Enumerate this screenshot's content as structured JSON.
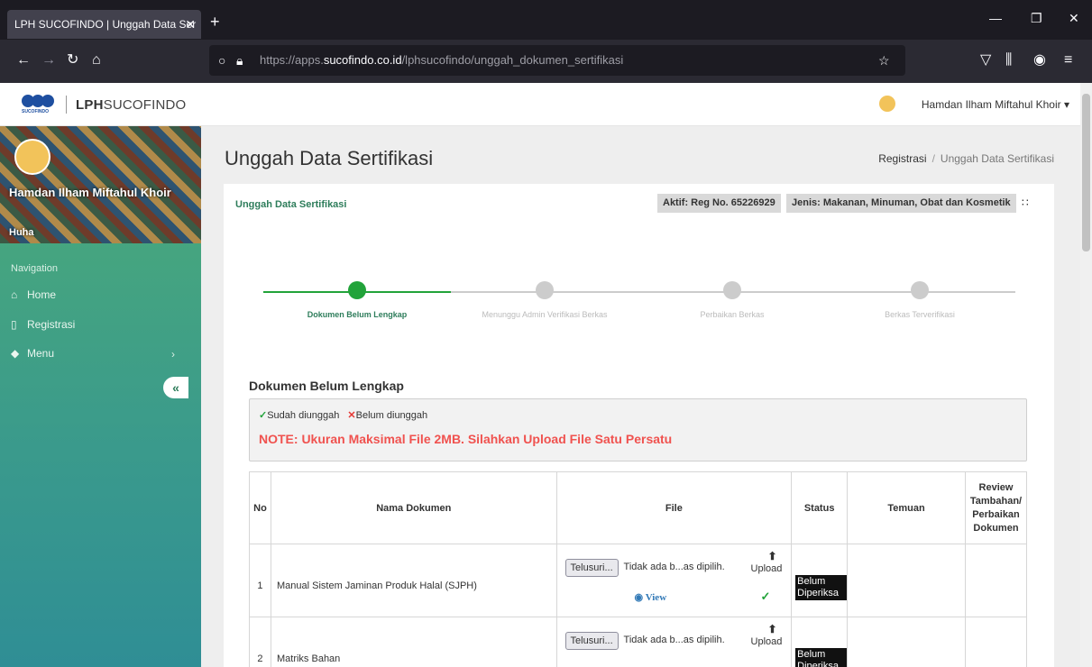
{
  "browser": {
    "tab_title": "LPH SUCOFINDO | Unggah Data Ser",
    "tab_close": "✕",
    "new_tab": "+",
    "url_prefix": "https://apps.",
    "url_domain": "sucofindo.co.id",
    "url_path": "/lphsucofindo/unggah_dokumen_sertifikasi"
  },
  "header": {
    "logo_text": "SUCOFINDO",
    "brand_bold": "LPH",
    "brand_rest": "SUCOFINDO",
    "user_name": "Hamdan Ilham Miftahul Khoir"
  },
  "sidebar": {
    "profile_name": "Hamdan Ilham Miftahul Khoir",
    "profile_username": "Huha",
    "nav_label": "Navigation",
    "items": [
      {
        "label": "Home",
        "icon": "home-icon"
      },
      {
        "label": "Registrasi",
        "icon": "book-icon"
      },
      {
        "label": "Menu",
        "icon": "cube-icon"
      }
    ],
    "collapse_label": "«"
  },
  "main": {
    "page_title": "Unggah Data Sertifikasi",
    "breadcrumb": [
      "Registrasi",
      "Unggah Data Sertifikasi"
    ],
    "card_title": "Unggah Data Sertifikasi",
    "badge_reg": "Aktif: Reg No. 65226929",
    "badge_type": "Jenis: Makanan, Minuman, Obat dan Kosmetik",
    "steps": [
      {
        "label": "Dokumen Belum Lengkap",
        "active": true
      },
      {
        "label": "Menunggu Admin Verifikasi Berkas",
        "active": false
      },
      {
        "label": "Perbaikan Berkas",
        "active": false
      },
      {
        "label": "Berkas Terverifikasi",
        "active": false
      }
    ],
    "section_title": "Dokumen Belum Lengkap",
    "legend_ok": "Sudah diunggah",
    "legend_no": "Belum diunggah",
    "note": "NOTE: Ukuran Maksimal File 2MB. Silahkan Upload File Satu Persatu",
    "table": {
      "headers": [
        "No",
        "Nama Dokumen",
        "File",
        "Status",
        "Temuan",
        "Review Tambahan/ Perbaikan Dokumen"
      ],
      "browse_label": "Telusuri...",
      "no_file_text": "Tidak ada b...as dipilih.",
      "upload_label": "Upload",
      "view_label": "View",
      "rows": [
        {
          "no": "1",
          "name": "Manual Sistem Jaminan Produk Halal (SJPH)",
          "status": "Belum Diperiksa"
        },
        {
          "no": "2",
          "name": "Matriks Bahan",
          "status": "Belum Diperiksa"
        }
      ]
    }
  },
  "colors": {
    "accent_green": "#2e7d5b",
    "step_active": "#22a33a",
    "note_red": "#f0524f"
  }
}
